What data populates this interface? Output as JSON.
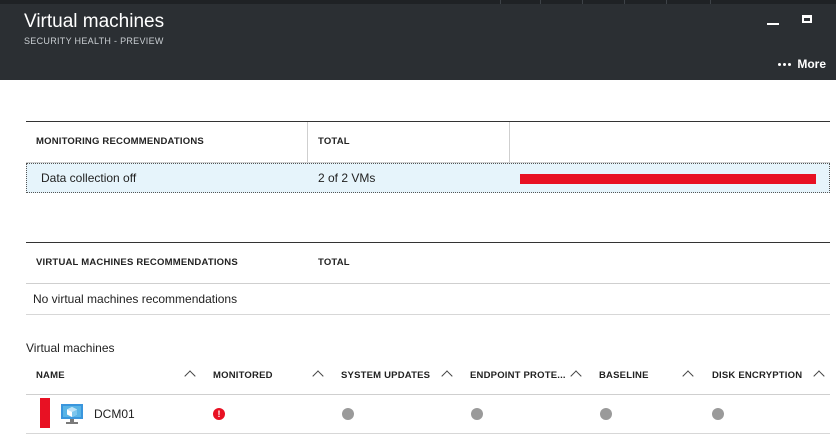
{
  "header": {
    "title": "Virtual machines",
    "subtitle": "SECURITY HEALTH - PREVIEW",
    "more_label": "More",
    "background": "#2b2f33"
  },
  "monitoring": {
    "col_recommendations": "MONITORING RECOMMENDATIONS",
    "col_total": "TOTAL",
    "rows": [
      {
        "name": "Data collection off",
        "total": "2 of 2 VMs",
        "fraction": 1.0,
        "bar_color": "#e81123"
      }
    ]
  },
  "vm_recommendations": {
    "col_recommendations": "VIRTUAL MACHINES RECOMMENDATIONS",
    "col_total": "TOTAL",
    "empty_text": "No virtual machines recommendations"
  },
  "vms": {
    "section_title": "Virtual machines",
    "columns": [
      "NAME",
      "MONITORED",
      "SYSTEM UPDATES",
      "ENDPOINT PROTE...",
      "BASELINE",
      "DISK ENCRYPTION"
    ],
    "rows": [
      {
        "name": "DCM01",
        "monitored": "alert",
        "system_updates": "none",
        "endpoint": "none",
        "baseline": "none",
        "disk_encryption": "none"
      }
    ]
  },
  "colors": {
    "accent_red": "#e81123",
    "selected_row": "#e6f4fb",
    "neutral_dot": "#9a9a9a"
  }
}
